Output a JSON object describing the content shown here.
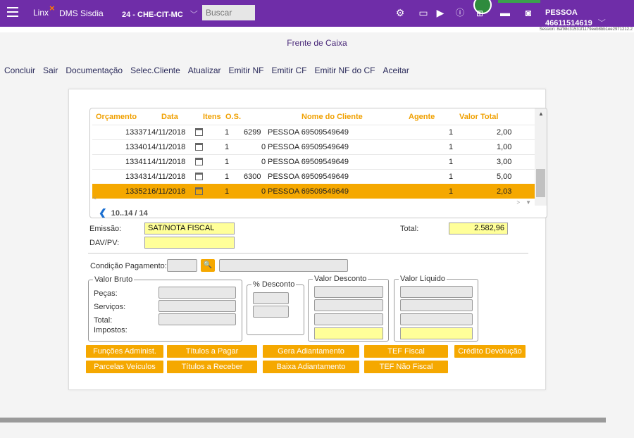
{
  "topbar": {
    "logo": "Linx",
    "app_name": "DMS Sisdia",
    "unit": "24 - CHE-CIT-MC",
    "search_placeholder": "Buscar",
    "user": "PESSOA 46611514619",
    "session": "Session: 8af98c31531f1179eeb8bb1ee2971212.2"
  },
  "page_title": "Frente de Caixa",
  "toolbar": [
    "Concluir",
    "Sair",
    "Documentação",
    "Selec.Cliente",
    "Atualizar",
    "Emitir NF",
    "Emitir CF",
    "Emitir NF do CF",
    "Aceitar"
  ],
  "grid": {
    "headers": [
      "Orçamento",
      "Data",
      "Itens",
      "O.S.",
      "Nome do Cliente",
      "Agente",
      "Valor Total"
    ],
    "rows": [
      {
        "orcamento": "13337",
        "data": "14/11/2018",
        "itens": "1",
        "os": "6299",
        "cliente": "PESSOA 69509549649",
        "agente": "1",
        "valor": "2,00",
        "selected": false
      },
      {
        "orcamento": "13340",
        "data": "14/11/2018",
        "itens": "1",
        "os": "0",
        "cliente": "PESSOA 69509549649",
        "agente": "1",
        "valor": "1,00",
        "selected": false
      },
      {
        "orcamento": "13341",
        "data": "14/11/2018",
        "itens": "1",
        "os": "0",
        "cliente": "PESSOA 69509549649",
        "agente": "1",
        "valor": "3,00",
        "selected": false
      },
      {
        "orcamento": "13343",
        "data": "14/11/2018",
        "itens": "1",
        "os": "6300",
        "cliente": "PESSOA 69509549649",
        "agente": "1",
        "valor": "5,00",
        "selected": false
      },
      {
        "orcamento": "13352",
        "data": "16/11/2018",
        "itens": "1",
        "os": "0",
        "cliente": "PESSOA 69509549649",
        "agente": "1",
        "valor": "2,03",
        "selected": true
      }
    ],
    "pager": "10..14 / 14"
  },
  "form": {
    "emissao_label": "Emissão:",
    "emissao_value": "SAT/NOTA FISCAL",
    "davpv_label": "DAV/PV:",
    "davpv_value": "",
    "total_label": "Total:",
    "total_value": "2.582,96",
    "condicao_label": "Condição Pagamento:"
  },
  "groups": {
    "valor_bruto": "Valor Bruto",
    "pecas": "Peças:",
    "servicos": "Serviços:",
    "total": "Total:",
    "impostos": "Impostos:",
    "pct_desconto": "% Desconto",
    "valor_desconto": "Valor Desconto",
    "valor_liquido": "Valor Líquido"
  },
  "buttons": {
    "funcoes": "Funções Administ.",
    "titulos_pagar": "Títulos a Pagar",
    "gera_adiantamento": "Gera Adiantamento",
    "tef_fiscal": "TEF Fiscal",
    "credito_devolucao": "Crédito Devolução",
    "parcelas": "Parcelas Veículos",
    "titulos_receber": "Títulos a Receber",
    "baixa_adiantamento": "Baixa Adiantamento",
    "tef_nao_fiscal": "TEF Não Fiscal"
  },
  "colors": {
    "topbar": "#6f2da8",
    "accent": "#f5a800",
    "field_yellow": "#ffff99"
  }
}
